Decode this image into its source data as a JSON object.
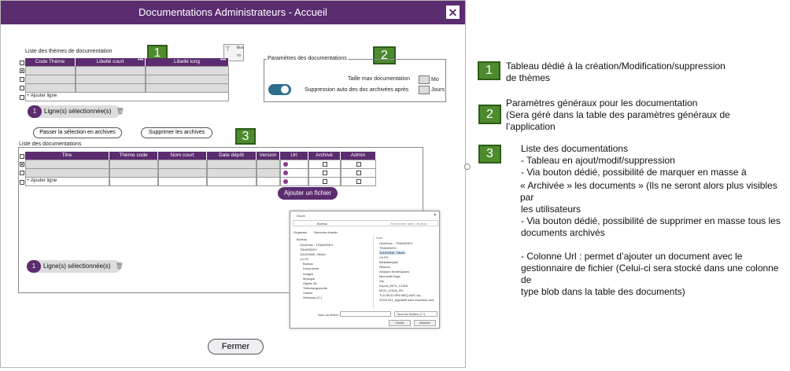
{
  "window": {
    "title": "Documentations Administrateurs - Accueil",
    "close_glyph": "✕",
    "close_button": "Fermer"
  },
  "themes": {
    "label": "Liste des thèmes de documentation",
    "columns": [
      "Code Thème",
      "Libellé court",
      "Libellé long"
    ],
    "add_row": "+ Ajouter ligne",
    "selected_count": "1",
    "selected_label": "Ligne(s) sélectionnée(s)",
    "filter_label": "filtre",
    "sort_label": "Tri"
  },
  "params": {
    "label": "Paramètres des documentations",
    "max_size_label": "Taille max documentation",
    "max_size_unit": "Mo",
    "auto_delete_label": "Suppression auto des doc archivées après",
    "auto_delete_unit": "Jours"
  },
  "docs": {
    "archive_button": "Passer la sélection en archives",
    "delete_archives_button": "Supprimer les archives",
    "label": "Liste des  documentations",
    "columns": [
      "Titre",
      "Thème code",
      "Nom court",
      "Date dépôt",
      "Version",
      "Url",
      "Archivé",
      "Admin"
    ],
    "add_row": "+ Ajouter ligne",
    "add_file_button": "Ajouter un fichier",
    "selected_count": "1",
    "selected_label": "Ligne(s) sélectionnée(s)"
  },
  "file_dialog": {
    "title": "Ouvrir",
    "path": "Bureau",
    "search": "Rechercher dans : Bureau",
    "organize": "Organiser",
    "new_folder": "Nouveau dossier",
    "tree": [
      "Bureau",
      "OneDrive - TRANSDEV",
      "TRANSDEV",
      "JULIENNE, Olivier",
      "Ce PC",
      "Bureau",
      "Documents",
      "Images",
      "Musique",
      "Objets 3D",
      "Téléchargements",
      "Vidéos",
      "Windows (C:)"
    ],
    "list_header": "Nom",
    "files": [
      "OneDrive - TRANSDEV",
      "TRANSDEV",
      "JULIENNE, Olivier",
      "Ce PC",
      "Bibliothèques",
      "Réseau",
      "Amazon WorkSpaces",
      "Microsoft Edge",
      "Vfs",
      "export_MCD_CODA",
      "MCD_CODA_RC",
      "TLD-MCD-IRN-MEQ-ADC.zip",
      "20211221_logiJobB suivi inventory and"
    ],
    "filename_label": "Nom du fichier :",
    "filter": "Tous les fichiers (*.*)",
    "open_button": "Ouvrir",
    "cancel_button": "Annuler"
  },
  "annotations": [
    {
      "badge": "1",
      "lines": [
        "Tableau dédié à la création/Modification/suppression",
        "de thèmes"
      ]
    },
    {
      "badge": "2",
      "lines": [
        "Paramètres généraux pour les documentation",
        "(Sera géré dans la table des paramètres généraux de",
        "l’application"
      ]
    },
    {
      "badge": "3",
      "lines": [
        "Liste des documentations",
        "  - Tableau en ajout/modif/suppression",
        "  - Via bouton dédié, possibilité de marquer en masse à",
        "« Archivée » les documents » (Ils ne seront alors plus visibles par",
        "les utilisateurs",
        "  - Via bouton dédié, possibilité de supprimer en masse tous les",
        "documents archivés",
        "",
        "  - Colonne Url : permet d’ajouter un document avec le",
        "gestionnaire de fichier (Celui-ci sera stocké dans une colonne de",
        "type blob dans la table des documents)"
      ]
    }
  ],
  "colors": {
    "purple": "#5b2c6f",
    "badge_green": "#4e8a2e"
  }
}
